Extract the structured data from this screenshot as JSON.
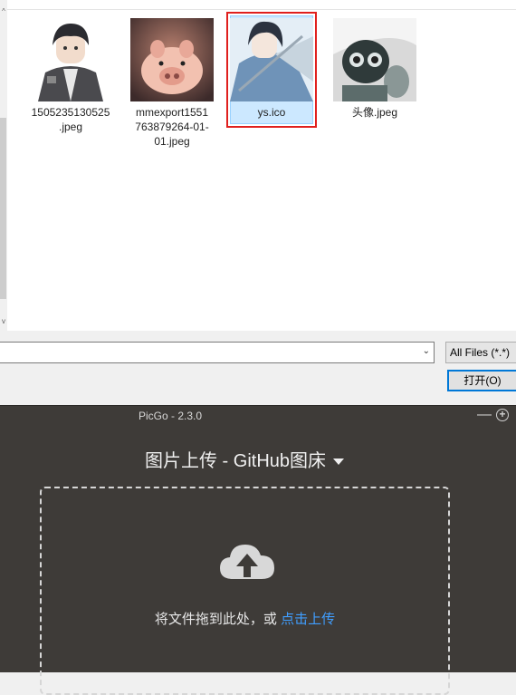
{
  "file_dialog": {
    "files": [
      {
        "name_lines": [
          "1505235130525",
          ".jpeg"
        ],
        "thumbnail": "anime-boy-hoodie-image",
        "selected": false
      },
      {
        "name_lines": [
          "mmexport1551",
          "763879264-01-",
          "01.jpeg"
        ],
        "thumbnail": "pig-plush-image",
        "selected": false
      },
      {
        "name_lines": [
          "ys.ico"
        ],
        "thumbnail": "anime-swordsman-image",
        "selected": true
      },
      {
        "name_lines": [
          "头像.jpeg"
        ],
        "thumbnail": "arale-figure-image",
        "selected": false
      }
    ],
    "filename_value": "",
    "filter_selected": "All Files (*.*)",
    "open_button_label": "打开(O)",
    "colors": {
      "selection_bg": "#cce8ff",
      "highlight_border": "#e0201e",
      "focus_blue": "#0078d7"
    }
  },
  "picgo": {
    "title": "PicGo - 2.3.0",
    "header_title": "图片上传 - GitHub图床",
    "drop_text": "将文件拖到此处，或 ",
    "upload_link": "点击上传",
    "colors": {
      "background": "#3e3b38",
      "link": "#409eff"
    }
  }
}
